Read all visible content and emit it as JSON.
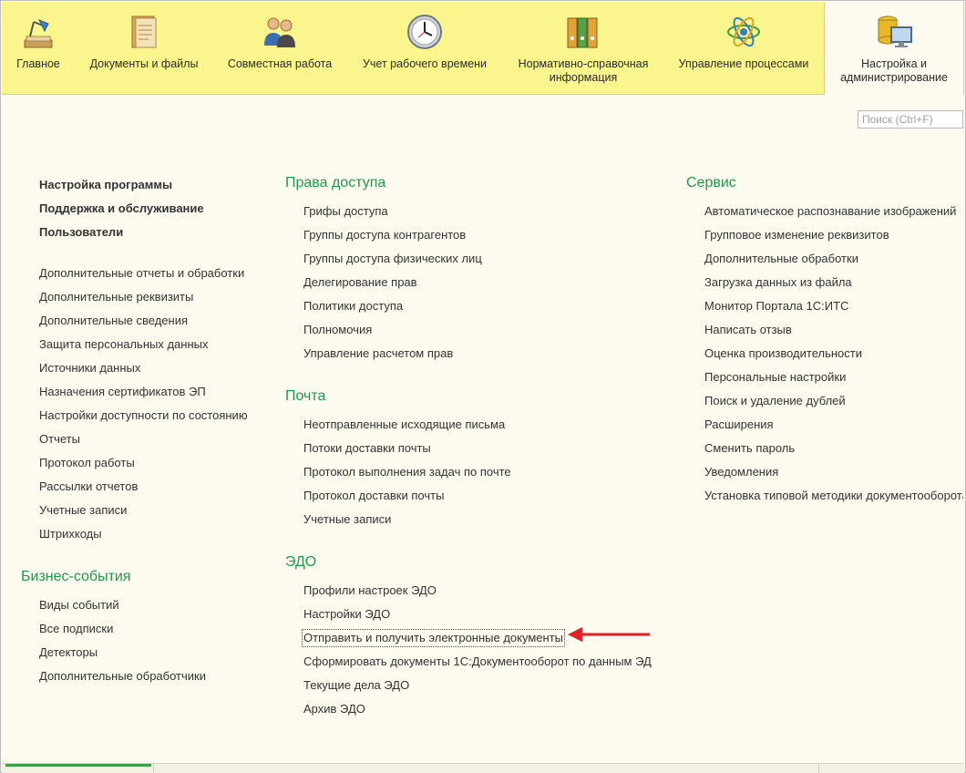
{
  "sections": [
    {
      "id": "main",
      "label": "Главное",
      "icon": "desk-lamp-icon"
    },
    {
      "id": "docs",
      "label": "Документы и файлы",
      "icon": "document-folder-icon"
    },
    {
      "id": "collab",
      "label": "Совместная работа",
      "icon": "people-icon"
    },
    {
      "id": "time",
      "label": "Учет рабочего времени",
      "icon": "clock-icon"
    },
    {
      "id": "ref",
      "label": "Нормативно-справочная информация",
      "icon": "binders-icon"
    },
    {
      "id": "proc",
      "label": "Управление процессами",
      "icon": "process-atom-icon"
    },
    {
      "id": "admin",
      "label": "Настройка и администрирование",
      "icon": "database-monitor-icon",
      "active": true
    }
  ],
  "search": {
    "placeholder": "Поиск (Ctrl+F)"
  },
  "left": {
    "top_links": [
      "Настройка программы",
      "Поддержка и обслуживание",
      "Пользователи"
    ],
    "links": [
      "Дополнительные отчеты и обработки",
      "Дополнительные реквизиты",
      "Дополнительные сведения",
      "Защита персональных данных",
      "Источники данных",
      "Назначения сертификатов ЭП",
      "Настройки доступности по состоянию",
      "Отчеты",
      "Протокол работы",
      "Рассылки отчетов",
      "Учетные записи",
      "Штрихкоды"
    ],
    "business_title": "Бизнес-события",
    "business_links": [
      "Виды событий",
      "Все подписки",
      "Детекторы",
      "Дополнительные обработчики"
    ]
  },
  "middle": {
    "access_title": "Права доступа",
    "access_links": [
      "Грифы доступа",
      "Группы доступа контрагентов",
      "Группы доступа физических лиц",
      "Делегирование прав",
      "Политики доступа",
      "Полномочия",
      "Управление расчетом прав"
    ],
    "mail_title": "Почта",
    "mail_links": [
      "Неотправленные исходящие письма",
      "Потоки доставки почты",
      "Протокол выполнения задач по почте",
      "Протокол доставки почты",
      "Учетные записи"
    ],
    "edo_title": "ЭДО",
    "edo_links": [
      "Профили настроек ЭДО",
      "Настройки ЭДО",
      "Отправить и получить электронные документы",
      "Сформировать документы 1С:Документооборот по данным ЭД",
      "Текущие дела ЭДО",
      "Архив ЭДО"
    ]
  },
  "right": {
    "service_title": "Сервис",
    "service_links": [
      "Автоматическое распознавание изображений",
      "Групповое изменение реквизитов",
      "Дополнительные обработки",
      "Загрузка данных из файла",
      "Монитор Портала 1С:ИТС",
      "Написать отзыв",
      "Оценка производительности",
      "Персональные настройки",
      "Поиск и удаление дублей",
      "Расширения",
      "Сменить пароль",
      "Уведомления",
      "Установка типовой методики документооборота"
    ]
  },
  "colors": {
    "topbar": "#faf58c",
    "group_title": "#1f9a4a",
    "arrow": "#e31e24",
    "background": "#fdfbf0"
  }
}
